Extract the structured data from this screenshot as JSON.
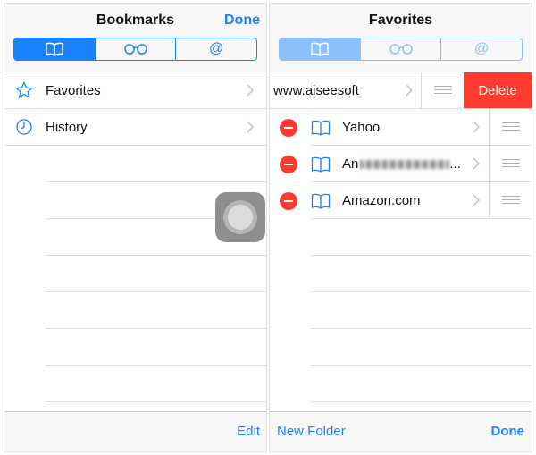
{
  "left": {
    "title": "Bookmarks",
    "done_label": "Done",
    "segments": [
      {
        "icon": "book-icon",
        "glyph": ""
      },
      {
        "icon": "glasses-icon",
        "glyph": ""
      },
      {
        "icon": "at-icon",
        "glyph": "@"
      }
    ],
    "items": [
      {
        "label": "Favorites",
        "icon": "star-icon"
      },
      {
        "label": "History",
        "icon": "clock-icon"
      }
    ],
    "edit_label": "Edit"
  },
  "right": {
    "title": "Favorites",
    "segments": [
      {
        "icon": "book-icon",
        "glyph": ""
      },
      {
        "icon": "glasses-icon",
        "glyph": ""
      },
      {
        "icon": "at-icon",
        "glyph": "@"
      }
    ],
    "swiped_item": {
      "label": "www.aiseesoft",
      "delete_label": "Delete"
    },
    "items": [
      {
        "label": "Yahoo"
      },
      {
        "label": "An",
        "ellipsis": "..."
      },
      {
        "label": "Amazon.com"
      }
    ],
    "new_folder_label": "New Folder",
    "done_label": "Done"
  },
  "colors": {
    "accent": "#1a82fb",
    "delete": "#ff3b30"
  }
}
